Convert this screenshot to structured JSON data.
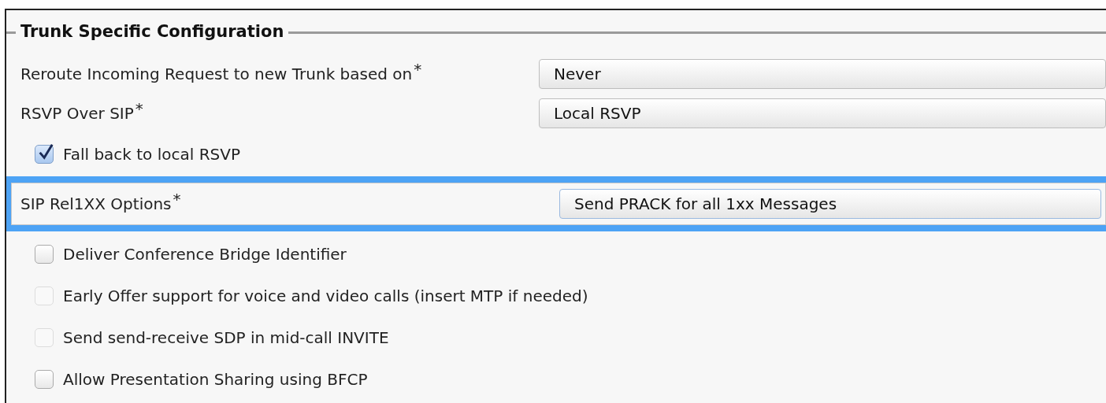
{
  "section": {
    "title": "Trunk Specific Configuration"
  },
  "rows": [
    {
      "kind": "select",
      "label": "Reroute Incoming Request to new Trunk based on",
      "required_mark": "*",
      "value": "Never",
      "highlighted": false
    },
    {
      "kind": "select",
      "label": "RSVP Over SIP",
      "required_mark": "*",
      "value": "Local RSVP",
      "highlighted": false
    },
    {
      "kind": "checkbox",
      "label": "Fall back to local RSVP",
      "checked": true,
      "disabled": false
    },
    {
      "kind": "select",
      "label": "SIP Rel1XX Options",
      "required_mark": "*",
      "value": "Send PRACK for all 1xx Messages",
      "highlighted": true
    },
    {
      "kind": "checkbox",
      "label": "Deliver Conference Bridge Identifier",
      "checked": false,
      "disabled": false
    },
    {
      "kind": "checkbox",
      "label": "Early Offer support for voice and video calls (insert MTP if needed)",
      "checked": false,
      "disabled": true
    },
    {
      "kind": "checkbox",
      "label": "Send send-receive SDP in mid-call INVITE",
      "checked": false,
      "disabled": true
    },
    {
      "kind": "checkbox",
      "label": "Allow Presentation Sharing using BFCP",
      "checked": false,
      "disabled": false
    }
  ]
}
